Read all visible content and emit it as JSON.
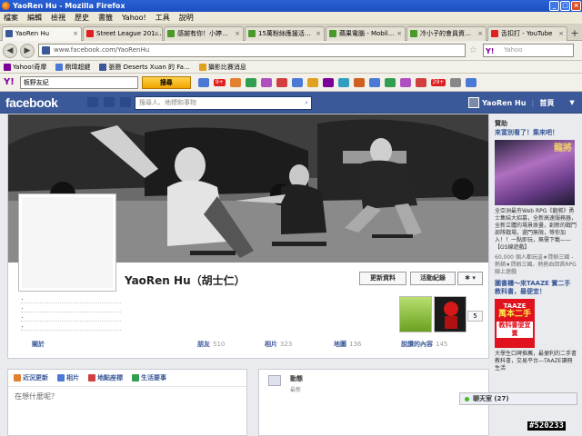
{
  "window": {
    "title": "YaoRen Hu - Mozilla Firefox",
    "controls": [
      "_",
      "□",
      "×"
    ]
  },
  "menu": [
    "檔案",
    "編輯",
    "檢視",
    "歷史",
    "書籤",
    "Yahoo!",
    "工具",
    "說明"
  ],
  "tabs": [
    {
      "label": "YaoRen Hu",
      "icon_color": "#3b5998",
      "active": true
    },
    {
      "label": "Street League 201…",
      "icon_color": "#e02020",
      "active": false
    },
    {
      "label": "感謝有你！小婷…",
      "icon_color": "#4a9a2a",
      "active": false
    },
    {
      "label": "15萬粉絲應援活…",
      "icon_color": "#4a9a2a",
      "active": false
    },
    {
      "label": "蘋果電腦 - Mobil…",
      "icon_color": "#4a9a2a",
      "active": false
    },
    {
      "label": "冷小子的會員資…",
      "icon_color": "#4a9a2a",
      "active": false
    },
    {
      "label": "舌扣打 - YouTube",
      "icon_color": "#e02020",
      "active": false
    }
  ],
  "navbar": {
    "url": "www.facebook.com/YaoRenHu",
    "search_placeholder": "Yahoo"
  },
  "bookmarks": [
    {
      "label": "Yahoo!奇摩",
      "icon_color": "#7b0099"
    },
    {
      "label": "鼎瑋超鍵",
      "icon_color": "#4a7ad6"
    },
    {
      "label": "張懸 Deserts Xuan 的 Fa…",
      "icon_color": "#3b5998"
    },
    {
      "label": "攝影比賽消息",
      "icon_color": "#e0a020"
    }
  ],
  "yahoo_toolbar": {
    "logo": "Y!",
    "input_value": "板野友紀",
    "search_button": "搜尋",
    "mail_badge": "9+",
    "other_badge": "29+"
  },
  "facebook": {
    "logo": "facebook",
    "search_placeholder": "搜尋人、地標和事物",
    "user_name": "YaoRen Hu",
    "home_label": "首頁",
    "profile_name": "YaoRen Hu（胡士仁）",
    "update_info_button": "更新資料",
    "activity_log_button": "活動紀錄",
    "settings_button": "✱ ▾",
    "apps_count": "5",
    "profile_info_lines": [
      "．",
      "．",
      "．",
      "．"
    ],
    "sections": [
      {
        "label": "關於",
        "count": ""
      },
      {
        "label": "朋友",
        "count": "510"
      },
      {
        "label": "相片",
        "count": "323"
      },
      {
        "label": "地圖",
        "count": "136"
      },
      {
        "label": "說讚的內容",
        "count": "145"
      }
    ],
    "composer": {
      "tabs": [
        "近況更新",
        "相片",
        "地點座標",
        "生活要事"
      ],
      "placeholder": "在想什麼呢？"
    },
    "activity": {
      "title": "動態",
      "subtitle": "最新"
    },
    "chat_label": "聊天室 (27)"
  },
  "sidebar": {
    "header": "贊助",
    "ad1_title": "來富別看了！集來吧！",
    "ad1_logo": "龍將",
    "ad1_text": "全亞洲最夯Web RPG《龍將》勇士集結大招募，全新高速服務器，全新立體的場景原畫，創新的戰鬥部隊戰場，還門無限，等你加入！！一點即玩，無需下載——【GS線遊戲】",
    "ad1_likes": "60,000 個人都玩這★貸辦三國 - 熱銷★貸辦三國。熱熱血回首RPG線上遊戲",
    "ad2_title": "圖書櫃～來TAAZE 實二手教科書，最便宜！",
    "ad2_banner_top": "TAAZE",
    "ad2_banner_big": "萬本二手",
    "ad2_banner_bottom": "教科書便宜賣",
    "ad2_text": "大學生口碑推薦，最便利的二手書教科書，交易平台—TAAZE讀冊生活"
  },
  "colors": {
    "fb_blue": "#3b5998",
    "title_blue": "#1d4fc0",
    "taaze_red": "#e0121e"
  },
  "watermark": "#520233"
}
